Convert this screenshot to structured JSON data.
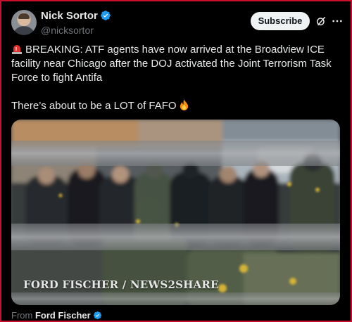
{
  "author": {
    "display_name": "Nick Sortor",
    "handle": "@nicksortor",
    "verified": true
  },
  "actions": {
    "subscribe_label": "Subscribe",
    "grok_icon": "grok-icon",
    "more_icon": "more-options-icon"
  },
  "tweet": {
    "line1": "BREAKING: ATF agents have now arrived at the Broadview ICE facility near Chicago after the DOJ activated the Joint Terrorism Task Force to fight Antifa",
    "line2": "There’s about to be a LOT of FAFO",
    "emoji_start": "rotating-light-icon",
    "emoji_end": "fire-icon"
  },
  "media": {
    "watermark": "FORD FISCHER / NEWS2SHARE"
  },
  "source": {
    "prefix": "From",
    "name": "Ford Fischer",
    "verified": true
  },
  "colors": {
    "background": "#000000",
    "text": "#e7e9ea",
    "secondary": "#71767b",
    "verified": "#1d9bf0",
    "button_bg": "#eff3f4",
    "frame_border": "#c8102e"
  }
}
